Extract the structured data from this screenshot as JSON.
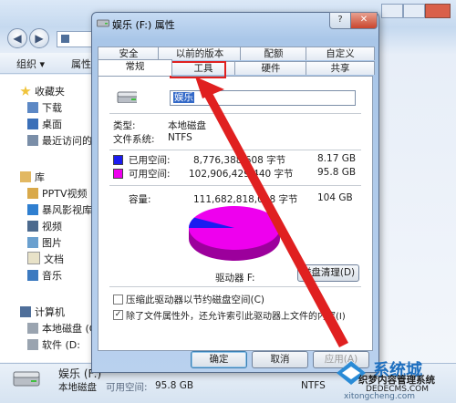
{
  "explorer": {
    "toolbar": {
      "organize": "组织 ▾",
      "properties": "属性"
    },
    "nav": {
      "favorites": "收藏夹",
      "downloads": "下载",
      "desktop": "桌面",
      "recent": "最近访问的",
      "library": "库",
      "pptv": "PPTV视频",
      "storm": "暴风影视库",
      "videos": "视频",
      "pictures": "图片",
      "documents": "文档",
      "music": "音乐",
      "computer": "计算机",
      "local_disk": "本地磁盘 (C",
      "software": "软件 (D:"
    },
    "status": {
      "drive_name": "娱乐 (F:)",
      "drive_type": "本地磁盘",
      "free_label": "可用空间:",
      "free_value": "95.8 GB",
      "fs": "NTFS"
    }
  },
  "dialog": {
    "title": "娱乐 (F:) 属性",
    "help": "?",
    "close": "✕",
    "tabs_row1": [
      "安全",
      "以前的版本",
      "配额",
      "自定义"
    ],
    "tabs_row2": [
      "常规",
      "工具",
      "硬件",
      "共享"
    ],
    "active_tab": "常规",
    "name_value": "娱乐",
    "type_label": "类型:",
    "type_value": "本地磁盘",
    "fs_label": "文件系统:",
    "fs_value": "NTFS",
    "used": {
      "label": "已用空间:",
      "bytes": "8,776,388,608 字节",
      "size": "8.17 GB",
      "color": "#1c1cf0"
    },
    "free": {
      "label": "可用空间:",
      "bytes": "102,906,429,440 字节",
      "size": "95.8 GB",
      "color": "#ee00ee"
    },
    "capacity": {
      "label": "容量:",
      "bytes": "111,682,818,048 字节",
      "size": "104 GB"
    },
    "drive_label": "驱动器 F:",
    "cleanup_button": "磁盘清理(D)",
    "compress_label": "压缩此驱动器以节约磁盘空间(C)",
    "index_label": "除了文件属性外，还允许索引此驱动器上文件的内容(I)",
    "ok": "确定",
    "cancel": "取消",
    "apply": "应用(A)"
  },
  "watermark": {
    "brand": "系统城",
    "site_cn": "织梦内容管理系统",
    "site_en": "DEDECMS.COM",
    "domain": "xitongcheng.com"
  }
}
